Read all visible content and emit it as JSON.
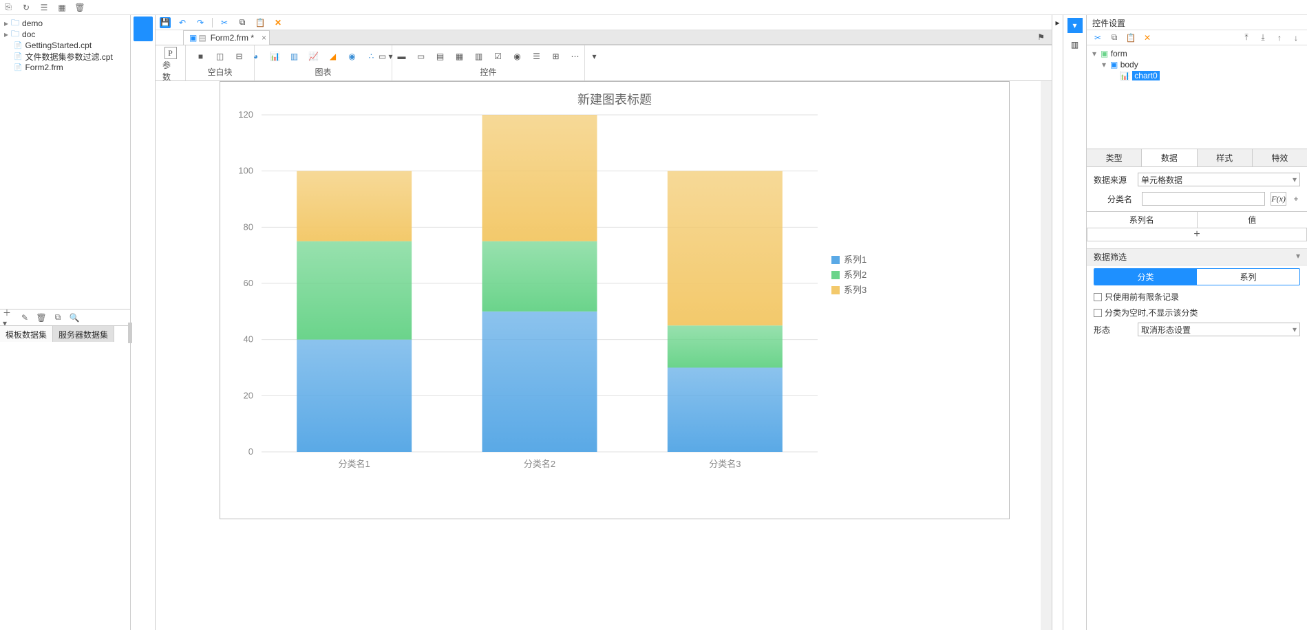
{
  "top_toolbar": [
    "new",
    "refresh",
    "layout",
    "grid",
    "delete"
  ],
  "file_tree": {
    "folders": [
      {
        "name": "demo",
        "expanded": false
      },
      {
        "name": "doc",
        "expanded": false
      }
    ],
    "files": [
      "GettingStarted.cpt",
      "文件数据集参数过滤.cpt",
      "Form2.frm"
    ]
  },
  "dataset_tabs": {
    "template": "模板数据集",
    "server": "服务器数据集"
  },
  "center_toolbar": {
    "save": "💾"
  },
  "doc_tab": {
    "label": "Form2.frm *"
  },
  "ribbon": {
    "param": "参数",
    "blank": "空白块",
    "chart": "图表",
    "widget": "控件"
  },
  "chart_data": {
    "type": "bar",
    "title": "新建图表标题",
    "categories": [
      "分类名1",
      "分类名2",
      "分类名3"
    ],
    "series": [
      {
        "name": "系列1",
        "values": [
          40,
          50,
          30
        ],
        "color": "#5aa9e6"
      },
      {
        "name": "系列2",
        "values": [
          35,
          25,
          15
        ],
        "color": "#6bd48b"
      },
      {
        "name": "系列3",
        "values": [
          25,
          45,
          55
        ],
        "color": "#f3c96b"
      }
    ],
    "yticks": [
      0,
      20,
      40,
      60,
      80,
      100,
      120
    ],
    "ylim": [
      0,
      120
    ],
    "stacked": true
  },
  "right_panel": {
    "title": "控件设置",
    "tree": {
      "root": "form",
      "body": "body",
      "chart": "chart0"
    },
    "tabs": {
      "type": "类型",
      "data": "数据",
      "style": "样式",
      "effect": "特效"
    },
    "data_source": {
      "label": "数据来源",
      "value": "单元格数据"
    },
    "category": {
      "label": "分类名",
      "value": ""
    },
    "series_cols": {
      "name": "系列名",
      "value": "值"
    },
    "add": "+",
    "filter": {
      "header": "数据筛选",
      "category": "分类",
      "series": "系列",
      "limit": "只使用前有限条记录",
      "hide_empty": "分类为空时,不显示该分类"
    },
    "shape": {
      "label": "形态",
      "value": "取消形态设置"
    }
  }
}
